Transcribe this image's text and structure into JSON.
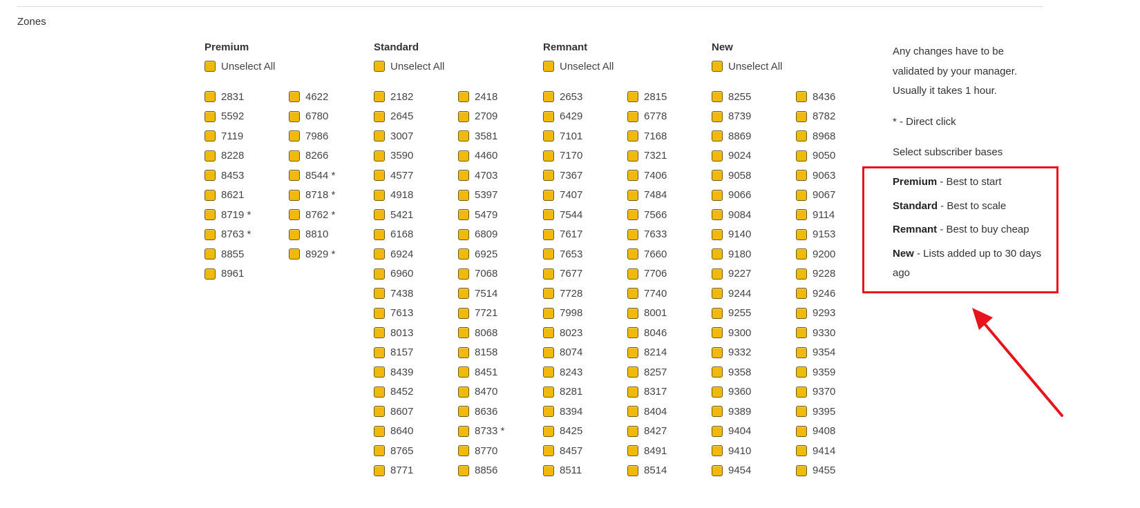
{
  "section_label": "Zones",
  "groups": [
    {
      "title": "Premium",
      "unselect_label": "Unselect All",
      "zones": [
        "2831",
        "4622",
        "5592",
        "6780",
        "7119",
        "7986",
        "8228",
        "8266",
        "8453",
        "8544 *",
        "8621",
        "8718 *",
        "8719 *",
        "8762 *",
        "8763 *",
        "8810",
        "8855",
        "8929 *",
        "8961"
      ]
    },
    {
      "title": "Standard",
      "unselect_label": "Unselect All",
      "zones": [
        "2182",
        "2418",
        "2645",
        "2709",
        "3007",
        "3581",
        "3590",
        "4460",
        "4577",
        "4703",
        "4918",
        "5397",
        "5421",
        "5479",
        "6168",
        "6809",
        "6924",
        "6925",
        "6960",
        "7068",
        "7438",
        "7514",
        "7613",
        "7721",
        "8013",
        "8068",
        "8157",
        "8158",
        "8439",
        "8451",
        "8452",
        "8470",
        "8607",
        "8636",
        "8640",
        "8733 *",
        "8765",
        "8770",
        "8771",
        "8856"
      ]
    },
    {
      "title": "Remnant",
      "unselect_label": "Unselect All",
      "zones": [
        "2653",
        "2815",
        "6429",
        "6778",
        "7101",
        "7168",
        "7170",
        "7321",
        "7367",
        "7406",
        "7407",
        "7484",
        "7544",
        "7566",
        "7617",
        "7633",
        "7653",
        "7660",
        "7677",
        "7706",
        "7728",
        "7740",
        "7998",
        "8001",
        "8023",
        "8046",
        "8074",
        "8214",
        "8243",
        "8257",
        "8281",
        "8317",
        "8394",
        "8404",
        "8425",
        "8427",
        "8457",
        "8491",
        "8511",
        "8514"
      ]
    },
    {
      "title": "New",
      "unselect_label": "Unselect All",
      "zones": [
        "8255",
        "8436",
        "8739",
        "8782",
        "8869",
        "8968",
        "9024",
        "9050",
        "9058",
        "9063",
        "9066",
        "9067",
        "9084",
        "9114",
        "9140",
        "9153",
        "9180",
        "9200",
        "9227",
        "9228",
        "9244",
        "9246",
        "9255",
        "9293",
        "9300",
        "9330",
        "9332",
        "9354",
        "9358",
        "9359",
        "9360",
        "9370",
        "9389",
        "9395",
        "9404",
        "9408",
        "9410",
        "9414",
        "9454",
        "9455"
      ]
    }
  ],
  "info": {
    "line1": "Any changes have to be",
    "line2": "validated by your manager.",
    "line3": "Usually it takes 1 hour.",
    "direct_click": "* - Direct click",
    "select_bases": "Select subscriber bases"
  },
  "legend": [
    {
      "name": "Premium",
      "desc": " - Best to start"
    },
    {
      "name": "Standard",
      "desc": " - Best to scale"
    },
    {
      "name": "Remnant",
      "desc": " - Best to buy cheap"
    },
    {
      "name": "New",
      "desc": " - Lists added up to 30 days ago"
    }
  ],
  "colors": {
    "checkbox_fill": "#f0b90b",
    "highlight_border": "#e8141c"
  }
}
